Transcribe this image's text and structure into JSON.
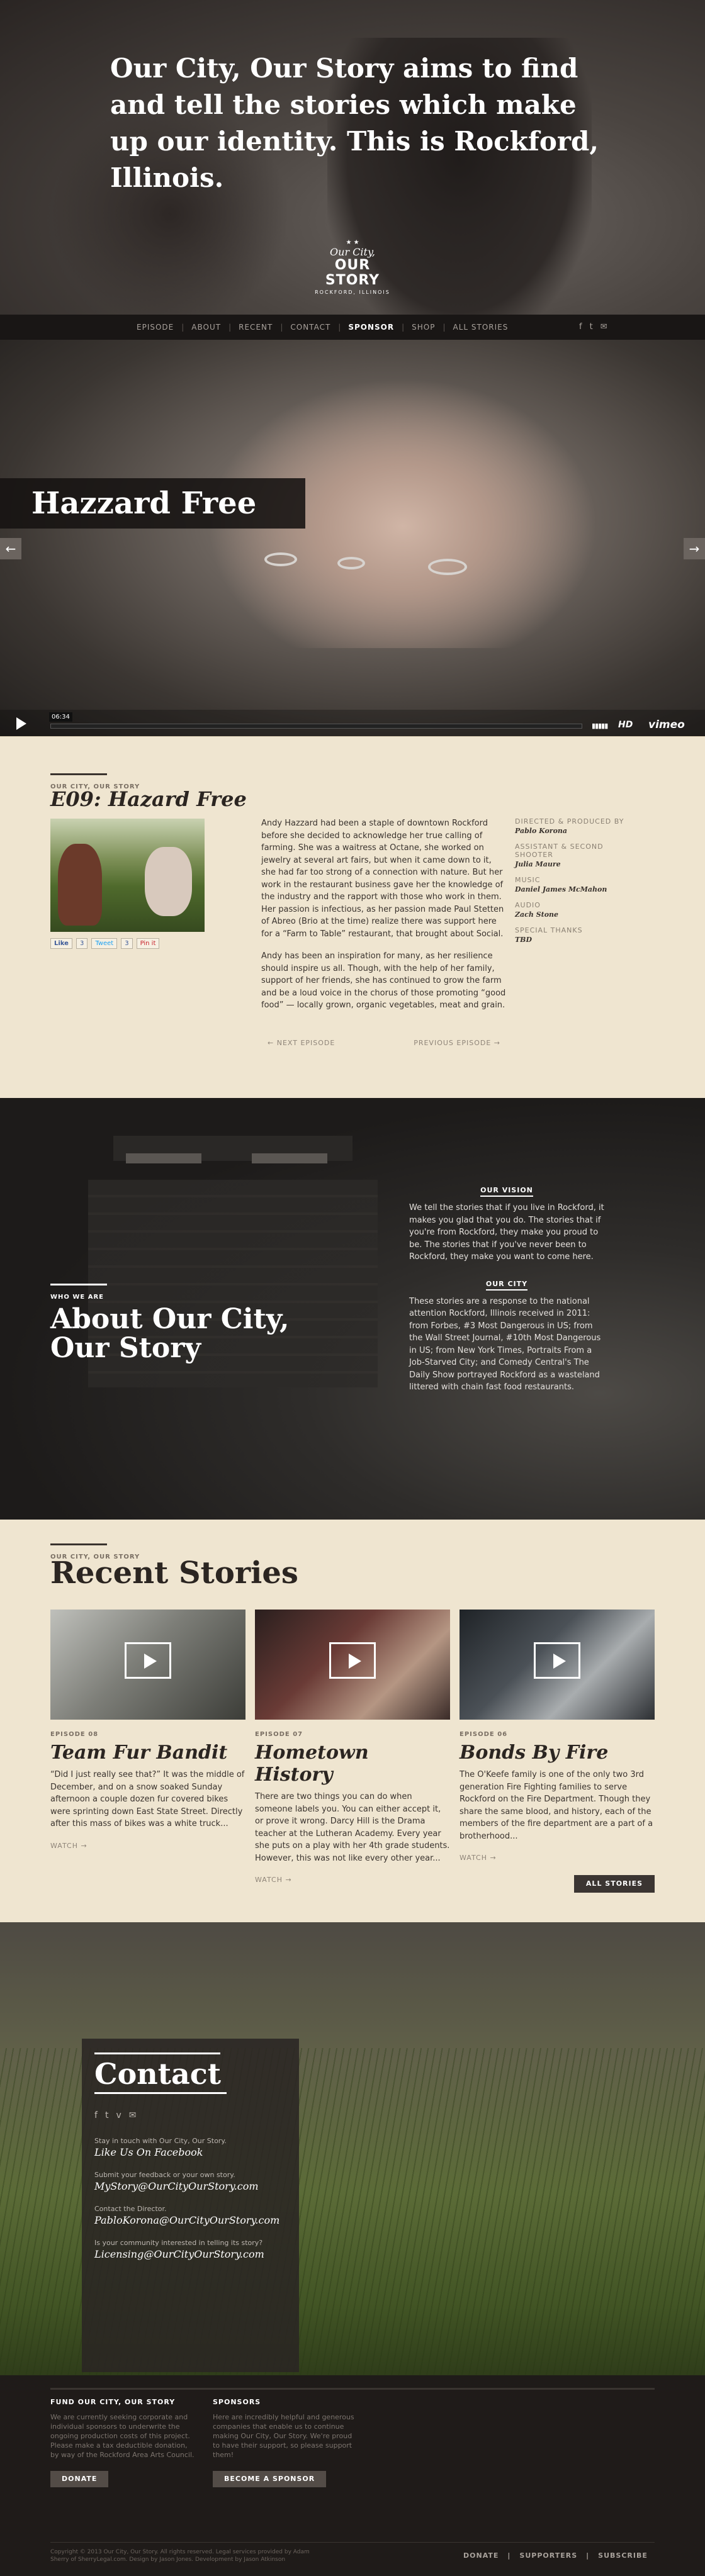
{
  "hero": {
    "tagline": "Our City, Our Story aims to find and tell the stories which make up our identity. This is Rockford, Illinois.",
    "logo_line1": "Our City,",
    "logo_line2": "OUR STORY",
    "logo_line3": "ROCKFORD, ILLINOIS"
  },
  "nav": {
    "items": [
      "EPISODE",
      "ABOUT",
      "RECENT",
      "CONTACT",
      "SPONSOR",
      "SHOP",
      "ALL STORIES"
    ],
    "active": "SPONSOR",
    "social_icons": [
      "facebook-icon",
      "twitter-icon",
      "mail-icon"
    ]
  },
  "video": {
    "title": "Hazzard Free",
    "prev_arrow": "←",
    "next_arrow": "→",
    "time": "06:34",
    "hd_label": "HD",
    "vimeo_label": "vimeo"
  },
  "episode": {
    "kicker": "OUR CITY, OUR STORY",
    "title": "E09: Hazard Free",
    "paragraphs": [
      "Andy Hazzard had been a staple of downtown Rockford before she decided to acknowledge her true calling of farming. She was a waitress at Octane, she worked on jewelry at several art fairs, but when it came down to it, she had far too strong of a connection with nature. But her work in the restaurant business gave her the knowledge of the industry and the rapport with those who work in them. Her passion is infectious, as her passion made Paul Stetten of Abreo (Brio at the time) realize there was support here for a “Farm to Table” restaurant, that brought about Social.",
      "Andy has been an inspiration for many, as her resilience should inspire us all. Though, with the help of her family, support of her friends, she has continued to grow the farm and be a loud voice in the chorus of those promoting “good food” — locally grown, organic vegetables, meat and grain."
    ],
    "share": {
      "like": "Like",
      "like_count": "3",
      "tweet": "Tweet",
      "tweet_count": "3",
      "pin": "Pin it"
    },
    "next_label": "← NEXT EPISODE",
    "prev_label": "PREVIOUS EPISODE →",
    "credits": [
      {
        "role": "DIRECTED & PRODUCED BY",
        "name": "Pablo Korona"
      },
      {
        "role": "ASSISTANT & SECOND SHOOTER",
        "name": "Julia Maure"
      },
      {
        "role": "MUSIC",
        "name": "Daniel James McMahon"
      },
      {
        "role": "AUDIO",
        "name": "Zach Stone"
      },
      {
        "role": "SPECIAL THANKS",
        "name": "TBD"
      }
    ]
  },
  "about": {
    "kicker": "WHO WE ARE",
    "title_line1": "About Our City,",
    "title_line2": "Our Story",
    "vision_head": "OUR VISION",
    "vision_text": "We tell the stories that if you live in Rockford, it makes you glad that you do. The stories that if you're from Rockford, they make you proud to be. The stories that if you've never been to Rockford, they make you want to come here.",
    "city_head": "OUR CITY",
    "city_text": "These stories are a response to the national attention Rockford, Illinois received in 2011: from Forbes, #3 Most Dangerous in US; from the Wall Street Journal, #10th Most Dangerous in US; from New York Times, Portraits From a Job-Starved City; and Comedy Central's The Daily Show portrayed Rockford as a wasteland littered with chain fast food restaurants."
  },
  "recent": {
    "kicker": "OUR CITY, OUR STORY",
    "title": "Recent Stories",
    "stories": [
      {
        "ep": "EPISODE 08",
        "title": "Team Fur Bandit",
        "desc": "“Did I just really see that?” It was the middle of December, and on a snow soaked Sunday afternoon a couple dozen fur covered bikes were sprinting down East State Street. Directly after this mass of bikes was a white truck...",
        "watch": "WATCH →"
      },
      {
        "ep": "EPISODE 07",
        "title": "Hometown History",
        "desc": "There are two things you can do when someone labels you. You can either accept it, or prove it wrong. Darcy Hill is the Drama teacher at the Lutheran Academy. Every year she puts on a play with her 4th grade students. However, this was not like every other year...",
        "watch": "WATCH →"
      },
      {
        "ep": "EPISODE 06",
        "title": "Bonds By Fire",
        "desc": "The O'Keefe family is one of the only two 3rd generation Fire Fighting families to serve Rockford on the Fire Department. Though they share the same blood, and history, each of the members of the fire department are a part of a brotherhood...",
        "watch": "WATCH →"
      }
    ],
    "all_label": "ALL STORIES"
  },
  "contact": {
    "title": "Contact",
    "social_icons": [
      "facebook-icon",
      "twitter-icon",
      "vimeo-icon",
      "mail-icon"
    ],
    "items": [
      {
        "label": "Stay in touch with Our City, Our Story.",
        "link": "Like Us On Facebook"
      },
      {
        "label": "Submit your feedback or your own story.",
        "link": "MyStory@OurCityOurStory.com"
      },
      {
        "label": "Contact the Director.",
        "link": "PabloKorona@OurCityOurStory.com"
      },
      {
        "label": "Is your community interested in telling its story?",
        "link": "Licensing@OurCityOurStory.com"
      }
    ]
  },
  "footer": {
    "fund_head": "FUND OUR CITY, OUR STORY",
    "fund_text": "We are currently seeking corporate and individual sponsors to underwrite the ongoing production costs of this project. Please make a tax deductible donation, by way of the Rockford Area Arts Council.",
    "donate": "DONATE",
    "sponsors_head": "SPONSORS",
    "sponsors_text": "Here are incredibly helpful and generous companies that enable us to continue making Our City, Our Story. We're proud to have their support, so please support them!",
    "become": "BECOME A SPONSOR",
    "copyright": "Copyright © 2013 Our City, Our Story. All rights reserved. Legal services provided by Adam Sherry of SherryLegal.com. Design by Jason Jones. Development by Jason Atkinson",
    "links": [
      "DONATE",
      "SUPPORTERS",
      "SUBSCRIBE"
    ]
  }
}
